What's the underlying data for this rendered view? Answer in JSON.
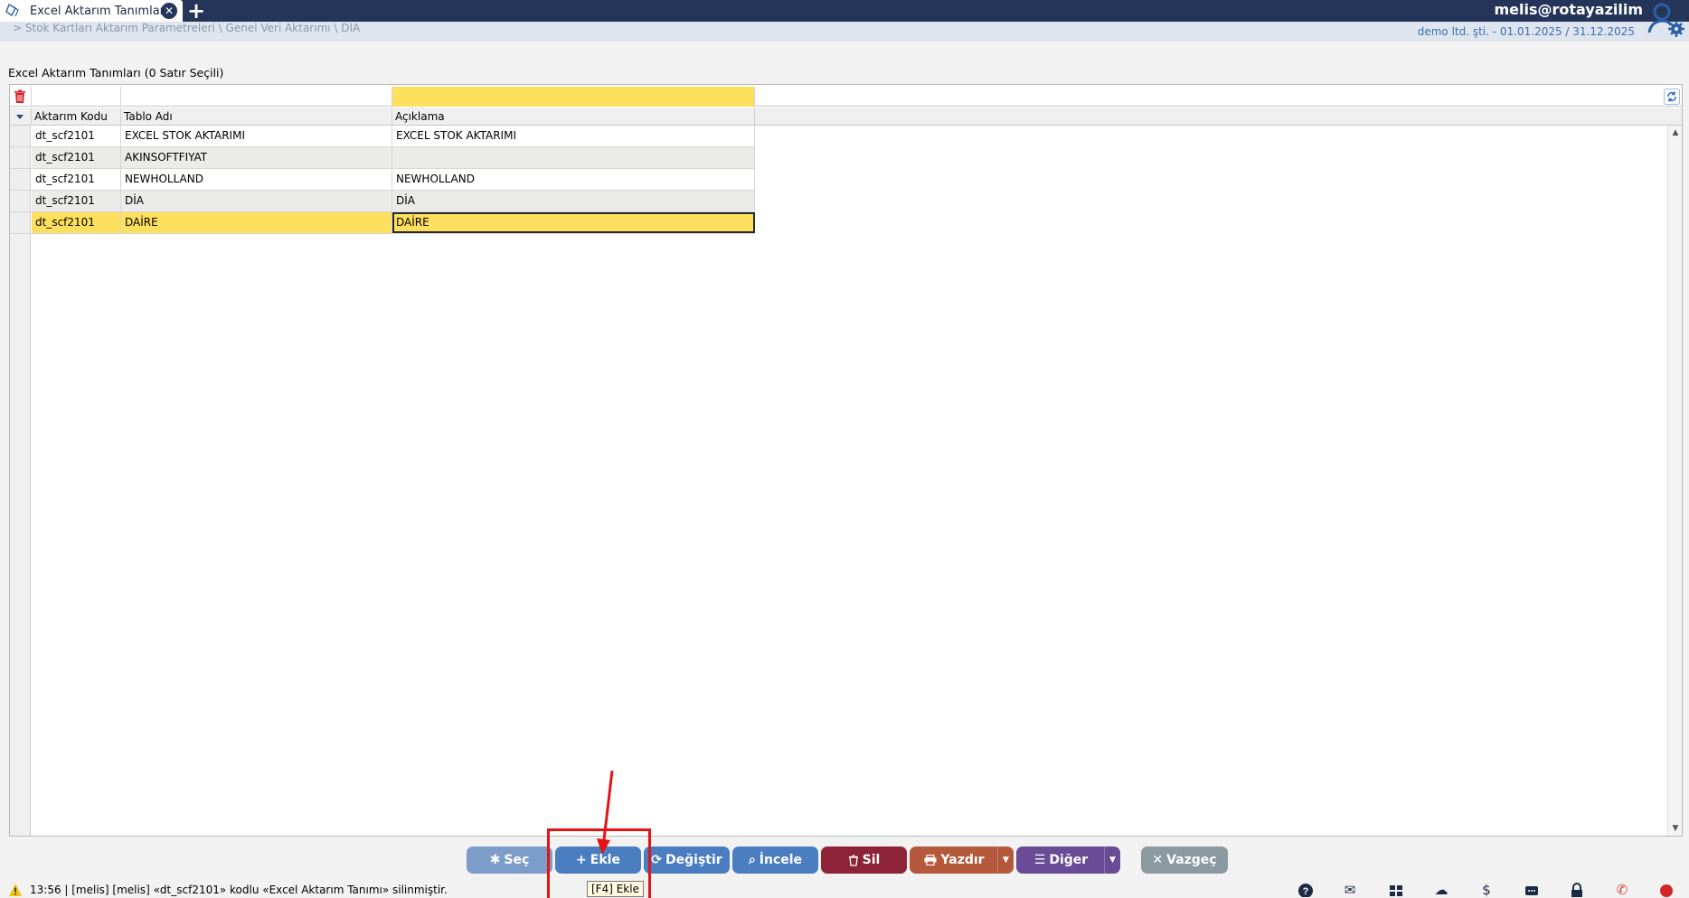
{
  "window": {
    "tab_title": "Excel Aktarım Tanımları",
    "close_glyph": "✕",
    "add_glyph": "+",
    "user": "melis@rotayazilim"
  },
  "subheader": {
    "breadcrumb": "> Stok Kartları Aktarım Parametreleri \\ Genel Veri Aktarımı \\ DİA",
    "company_info": "demo ltd. şti. - 01.01.2025 / 31.12.2025"
  },
  "grid": {
    "title": "Excel Aktarım Tanımları  (0 Satır Seçili)",
    "columns": [
      "Aktarım Kodu",
      "Tablo Adı",
      "Açıklama"
    ],
    "rows": [
      {
        "code": "dt_scf2101",
        "table": "EXCEL STOK AKTARIMI",
        "desc": "EXCEL STOK AKTARIMI"
      },
      {
        "code": "dt_scf2101",
        "table": "AKINSOFTFIYAT",
        "desc": ""
      },
      {
        "code": "dt_scf2101",
        "table": "NEWHOLLAND",
        "desc": "NEWHOLLAND"
      },
      {
        "code": "dt_scf2101",
        "table": "DİA",
        "desc": "DİA"
      },
      {
        "code": "dt_scf2101",
        "table": "DAİRE",
        "desc": "DAİRE"
      }
    ],
    "selected_row": 4,
    "highlight_color": "#ffdf5e"
  },
  "actions": {
    "sec": "Seç",
    "ekle": "Ekle",
    "degistir": "Değiştir",
    "incele": "İncele",
    "sil": "Sil",
    "yazdir": "Yazdır",
    "diger": "Diğer",
    "vazgec": "Vazgeç"
  },
  "tooltip": "[F4] Ekle",
  "status": {
    "message": "13:56 | [melis] [melis] «dt_scf2101» kodlu «Excel Aktarım Tanımı» silinmiştir."
  },
  "tray_icons": [
    "help-icon",
    "mail-icon",
    "apps-icon",
    "cloud-icon",
    "currency-icon",
    "chat-icon",
    "lock-icon",
    "phone-icon",
    "record-icon"
  ]
}
